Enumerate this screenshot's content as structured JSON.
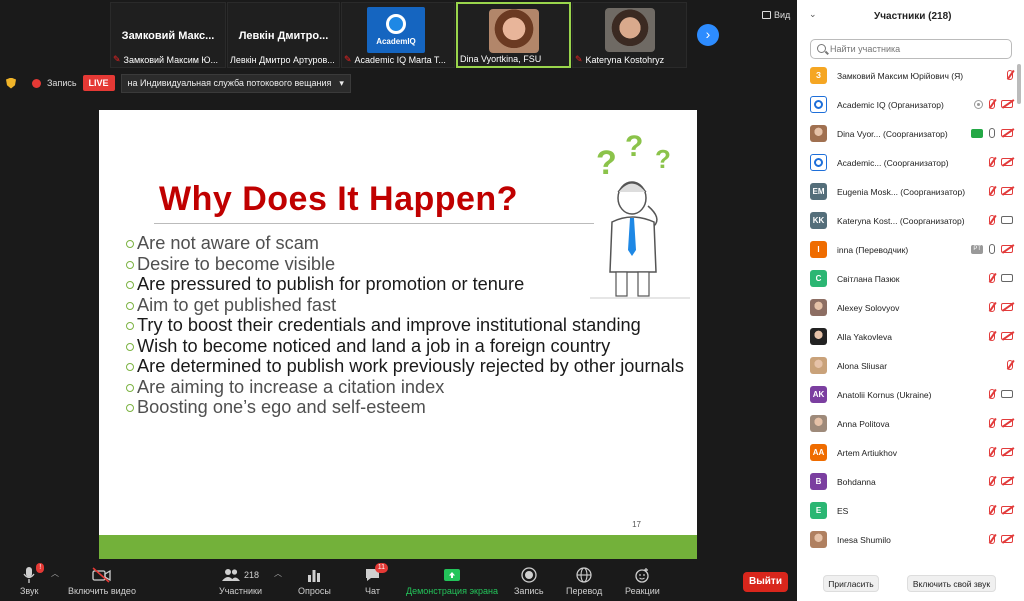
{
  "thumbnails": [
    {
      "big_name": "Замковий Макс...",
      "caption": "Замковий Максим Ю...",
      "kind": "name",
      "muted": true
    },
    {
      "big_name": "Левкін Дмитро...",
      "caption": "Левкін Дмитро Артуров...",
      "kind": "name",
      "muted": false
    },
    {
      "big_name": "",
      "caption": "Academic IQ Marta T...",
      "kind": "logo",
      "logo_text": "AcademIQ",
      "muted": true
    },
    {
      "big_name": "",
      "caption": "Dina Vyortkina, FSU",
      "kind": "face",
      "muted": false,
      "active": true
    },
    {
      "big_name": "",
      "caption": "Kateryna Kostohryz",
      "kind": "face",
      "muted": true
    }
  ],
  "view_label": "Вид",
  "recording": {
    "label": "Запись",
    "live": "LIVE",
    "stream_target": "на Индивидуальная служба потокового вещания",
    "dropdown_caret": "▾"
  },
  "slide": {
    "title": "Why Does It Happen?",
    "bullets": [
      "Are not aware of scam",
      "Desire to become visible",
      "Are pressured to publish for promotion or tenure",
      "Aim to get published fast",
      "Try to boost their credentials and improve institutional standing",
      "Wish to become noticed and land a job in a foreign country",
      "Are determined to publish work previously rejected by other journals",
      "Are aiming to increase a citation index",
      "Boosting one’s ego and self-esteem"
    ],
    "page_number": "17"
  },
  "toolbar": {
    "audio": "Звук",
    "video": "Включить видео",
    "participants": "Участники",
    "participants_count": "218",
    "polls": "Опросы",
    "chat": "Чат",
    "chat_badge": "11",
    "share": "Демонстрация экрана",
    "record": "Запись",
    "translate": "Перевод",
    "reactions": "Реакции",
    "leave": "Выйти",
    "audio_badge": "!"
  },
  "panel": {
    "title": "Участники (218)",
    "search_placeholder": "Найти участника",
    "invite": "Пригласить",
    "unmute_me": "Включить свой звук",
    "participants": [
      {
        "initials": "З",
        "color": "#f5a623",
        "name": "Замковий Максим Юрійович (Я)",
        "icons": [
          "mic-off"
        ]
      },
      {
        "initials": "",
        "color": "#1e6fd9",
        "avatar": "logo",
        "name": "Academic IQ (Организатор)",
        "icons": [
          "dot",
          "mic-off",
          "cam-off"
        ]
      },
      {
        "initials": "",
        "color": "#a07050",
        "avatar": "photo",
        "name": "Dina Vyor... (Соорганизатор)",
        "icons": [
          "screen",
          "mic",
          "cam-off"
        ]
      },
      {
        "initials": "",
        "color": "#1e6fd9",
        "avatar": "logo",
        "name": "Academic... (Соорганизатор)",
        "icons": [
          "mic-off",
          "cam-off"
        ]
      },
      {
        "initials": "EM",
        "color": "#546e7a",
        "name": "Eugenia Mosk... (Соорганизатор)",
        "icons": [
          "mic-off",
          "cam-off"
        ]
      },
      {
        "initials": "KK",
        "color": "#546e7a",
        "name": "Kateryna Kost... (Соорганизатор)",
        "icons": [
          "mic-off",
          "cam"
        ]
      },
      {
        "initials": "I",
        "color": "#ef6c00",
        "name": "inna (Переводчик)",
        "icons": [
          "pt",
          "mic",
          "cam-off"
        ]
      },
      {
        "initials": "С",
        "color": "#2bb673",
        "name": "Світлана Пазюк",
        "icons": [
          "mic-off",
          "cam"
        ]
      },
      {
        "initials": "",
        "color": "#8d6e63",
        "avatar": "photo",
        "name": "Alexey Solovyov",
        "icons": [
          "mic-off",
          "cam-off"
        ]
      },
      {
        "initials": "",
        "color": "#222222",
        "avatar": "photo",
        "name": "Alla Yakovleva",
        "icons": [
          "mic-off",
          "cam-off"
        ]
      },
      {
        "initials": "",
        "color": "#c9a27a",
        "avatar": "photo",
        "name": "Alona Sliusar",
        "icons": [
          "mic-off"
        ]
      },
      {
        "initials": "AK",
        "color": "#7b3fa0",
        "name": "Anatolii Kornus (Ukraine)",
        "icons": [
          "mic-off",
          "cam"
        ]
      },
      {
        "initials": "",
        "color": "#9e8a7a",
        "avatar": "photo",
        "name": "Anna Politova",
        "icons": [
          "mic-off",
          "cam-off"
        ]
      },
      {
        "initials": "AA",
        "color": "#ef6c00",
        "name": "Artem Artiukhov",
        "icons": [
          "mic-off",
          "cam-off"
        ]
      },
      {
        "initials": "B",
        "color": "#7b3fa0",
        "name": "Bohdanna",
        "icons": [
          "mic-off",
          "cam-off"
        ]
      },
      {
        "initials": "E",
        "color": "#2bb673",
        "name": "ES",
        "icons": [
          "mic-off",
          "cam-off"
        ]
      },
      {
        "initials": "",
        "color": "#b08060",
        "avatar": "photo",
        "name": "Inesa Shumilo",
        "icons": [
          "mic-off",
          "cam-off"
        ]
      }
    ]
  }
}
